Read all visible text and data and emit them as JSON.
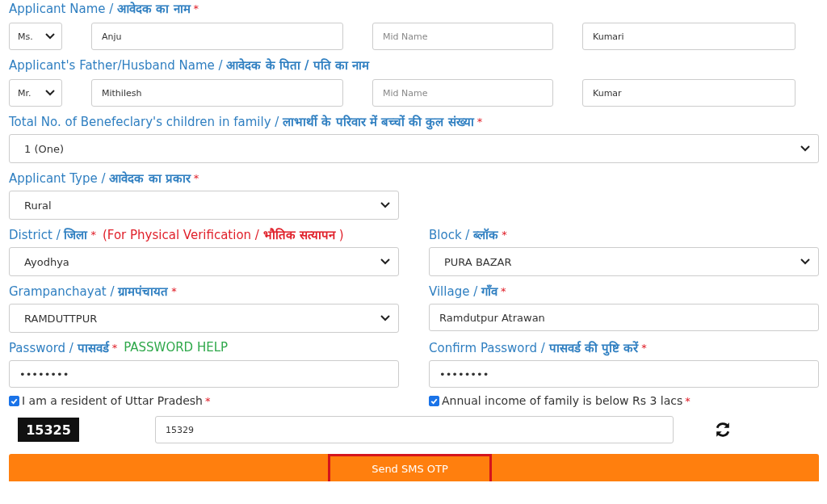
{
  "name_rows": [
    {
      "label": "Applicant Name / **आवेदक का नाम**",
      "required": "*",
      "salutation": "Ms.",
      "first_name": "Anju",
      "middle_name": {
        "placeholder": "Mid Name"
      },
      "last_name": "Kumari"
    },
    {
      "label": "Applicant's Father/Husband Name / **आवेदक के पिता / पति का नाम**",
      "salutation": "Mr.",
      "first_name": "Mithilesh",
      "middle_name": {
        "placeholder": "Mid Name"
      },
      "last_name": "Kumar"
    }
  ],
  "children": {
    "label": "Total No. of Benefeclary's children in family / **लाभार्थी के परिवार में बच्चों की कुल संख्या**",
    "required": "*",
    "value": "1 (One)"
  },
  "applicant_type": {
    "label": "Applicant Type / **आवेदक का प्रकार**",
    "required": "*",
    "value": "Rural"
  },
  "pairs": [
    [
      {
        "kind": "select",
        "label": "District / **जिला**",
        "required": "*",
        "note": "(For Physical Verification / **भौतिक सत्यापन** )",
        "value": "Ayodhya"
      },
      {
        "kind": "select",
        "label": "Block / **ब्लॉक**",
        "required": "*",
        "value": "PURA BAZAR"
      }
    ],
    [
      {
        "kind": "select",
        "label": "Grampanchayat / **ग्रामपंचायत**",
        "required": "*",
        "value": "RAMDUTTPUR"
      },
      {
        "kind": "input",
        "label": "Village / **गाँव**",
        "required": "*",
        "value": "Ramdutpur Atrawan"
      }
    ],
    [
      {
        "kind": "input",
        "label": "Password / **पासवर्ड**",
        "required": "*",
        "help": "PASSWORD HELP",
        "value": "••••••••"
      },
      {
        "kind": "input",
        "label": "Confirm Password / **पासवर्ड की पुष्टि करें**",
        "required": "*",
        "value": "••••••••"
      }
    ]
  ],
  "declarations": [
    {
      "label": "I am a resident of Uttar Pradesh",
      "required": "*",
      "checked": true
    },
    {
      "label": "Annual income of family is below Rs 3 lacs",
      "required": "*",
      "checked": true
    }
  ],
  "captcha": {
    "code": "15325",
    "value": "15329"
  },
  "submit": {
    "label": "Send SMS OTP",
    "highlighted": true
  }
}
